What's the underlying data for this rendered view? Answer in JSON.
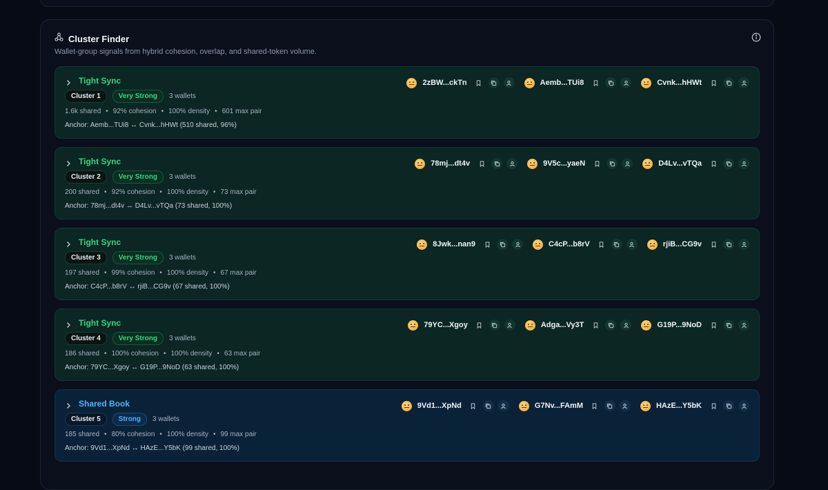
{
  "panel": {
    "title": "Cluster Finder",
    "subtitle": "Wallet-group signals from hybrid cohesion, overlap, and shared-token volume.",
    "icons": {
      "title": "cluster-icon",
      "info": "info-icon"
    }
  },
  "colors": {
    "accent_green": "#36d77f",
    "accent_blue": "#4fb2ff",
    "background": "#070b16"
  },
  "clusters": [
    {
      "type": "Tight Sync",
      "cluster_label": "Cluster 1",
      "strength": "Very Strong",
      "wallets_text": "3 wallets",
      "shared": "1.6k shared",
      "cohesion": "92% cohesion",
      "density": "100% density",
      "max_pair": "601 max pair",
      "anchor": "Anchor: Aemb...TUi8 ↔ Cvnk...hHWt (510 shared, 96%)",
      "wallets": [
        "2zBW...ckTn",
        "Aemb...TUi8",
        "Cvnk...hHWt"
      ]
    },
    {
      "type": "Tight Sync",
      "cluster_label": "Cluster 2",
      "strength": "Very Strong",
      "wallets_text": "3 wallets",
      "shared": "200 shared",
      "cohesion": "92% cohesion",
      "density": "100% density",
      "max_pair": "73 max pair",
      "anchor": "Anchor: 78mj...dt4v ↔ D4Lv...vTQa (73 shared, 100%)",
      "wallets": [
        "78mj...dt4v",
        "9V5c...yaeN",
        "D4Lv...vTQa"
      ]
    },
    {
      "type": "Tight Sync",
      "cluster_label": "Cluster 3",
      "strength": "Very Strong",
      "wallets_text": "3 wallets",
      "shared": "197 shared",
      "cohesion": "99% cohesion",
      "density": "100% density",
      "max_pair": "67 max pair",
      "anchor": "Anchor: C4cP...b8rV ↔ rjiB...CG9v (67 shared, 100%)",
      "wallets": [
        "8Jwk...nan9",
        "C4cP...b8rV",
        "rjiB...CG9v"
      ]
    },
    {
      "type": "Tight Sync",
      "cluster_label": "Cluster 4",
      "strength": "Very Strong",
      "wallets_text": "3 wallets",
      "shared": "186 shared",
      "cohesion": "100% cohesion",
      "density": "100% density",
      "max_pair": "63 max pair",
      "anchor": "Anchor: 79YC...Xgoy ↔ G19P...9NoD (63 shared, 100%)",
      "wallets": [
        "79YC...Xgoy",
        "Adga...Vy3T",
        "G19P...9NoD"
      ]
    },
    {
      "type": "Shared Book",
      "cluster_label": "Cluster 5",
      "strength": "Strong",
      "wallets_text": "3 wallets",
      "shared": "185 shared",
      "cohesion": "80% cohesion",
      "density": "100% density",
      "max_pair": "99 max pair",
      "anchor": "Anchor: 9Vd1...XpNd ↔ HAzE...Y5bK (99 shared, 100%)",
      "wallets": [
        "9Vd1...XpNd",
        "G7Nv...FAmM",
        "HAzE...Y5bK"
      ]
    }
  ]
}
